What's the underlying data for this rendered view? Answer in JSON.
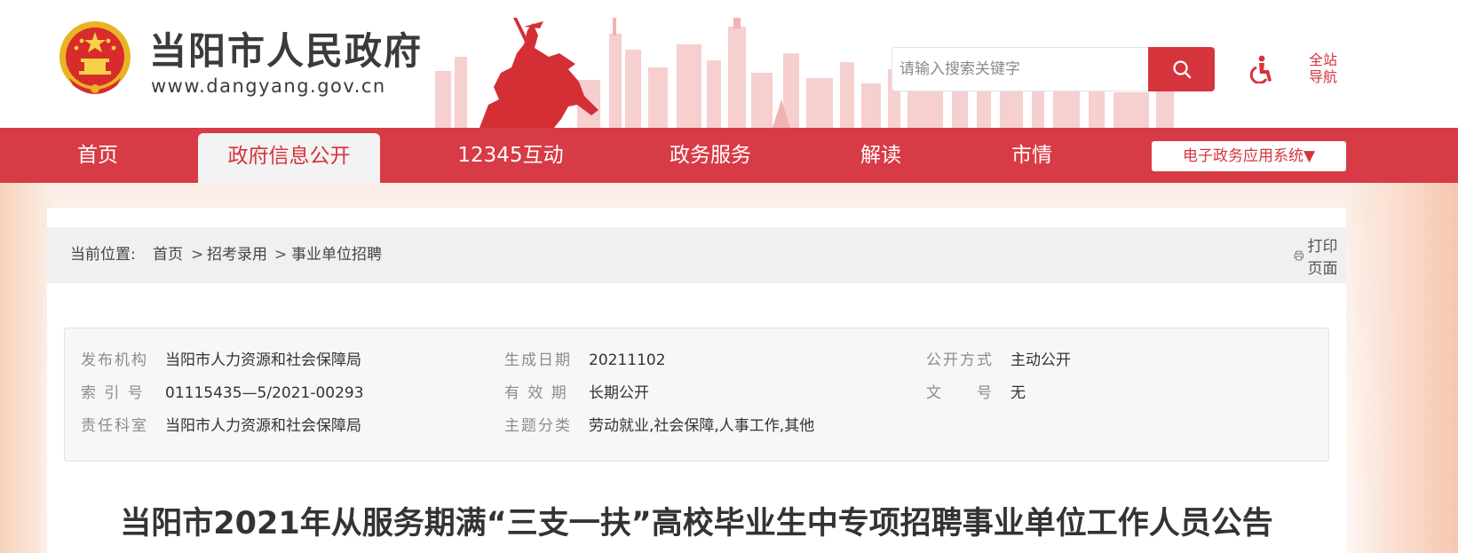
{
  "header": {
    "site_title": "当阳市人民政府",
    "site_url": "www.dangyang.gov.cn",
    "search_placeholder": "请输入搜索关键字",
    "nav_all": "全站导航",
    "nav_all_line1": "全站",
    "nav_all_line2": "导航",
    "accent_color": "#d5343d"
  },
  "nav": {
    "items": [
      {
        "label": "首页"
      },
      {
        "label": "政府信息公开"
      },
      {
        "label": "12345互动"
      },
      {
        "label": "政务服务"
      },
      {
        "label": "解读"
      },
      {
        "label": "市情"
      }
    ],
    "active": "政府信息公开",
    "egov_label": "电子政务应用系统▼"
  },
  "breadcrumb": {
    "prefix": "当前位置:",
    "items": [
      "首页",
      "招考录用",
      "事业单位招聘"
    ],
    "separator": ">",
    "print_label": "打印页面"
  },
  "meta": {
    "publisher_label": "发布机构",
    "publisher_value": "当阳市人力资源和社会保障局",
    "index_label": "索 引 号",
    "index_value": "01115435—5/2021-00293",
    "dept_label": "责任科室",
    "dept_value": "当阳市人力资源和社会保障局",
    "date_label": "生成日期",
    "date_value": "20211102",
    "valid_label": "有 效 期",
    "valid_value": "长期公开",
    "topic_label": "主题分类",
    "topic_value": "劳动就业,社会保障,人事工作,其他",
    "mode_label": "公开方式",
    "mode_value": "主动公开",
    "docno_label": "文　　号",
    "docno_value": "无"
  },
  "article": {
    "title": "当阳市2021年从服务期满“三支一扶”高校毕业生中专项招聘事业单位工作人员公告"
  }
}
